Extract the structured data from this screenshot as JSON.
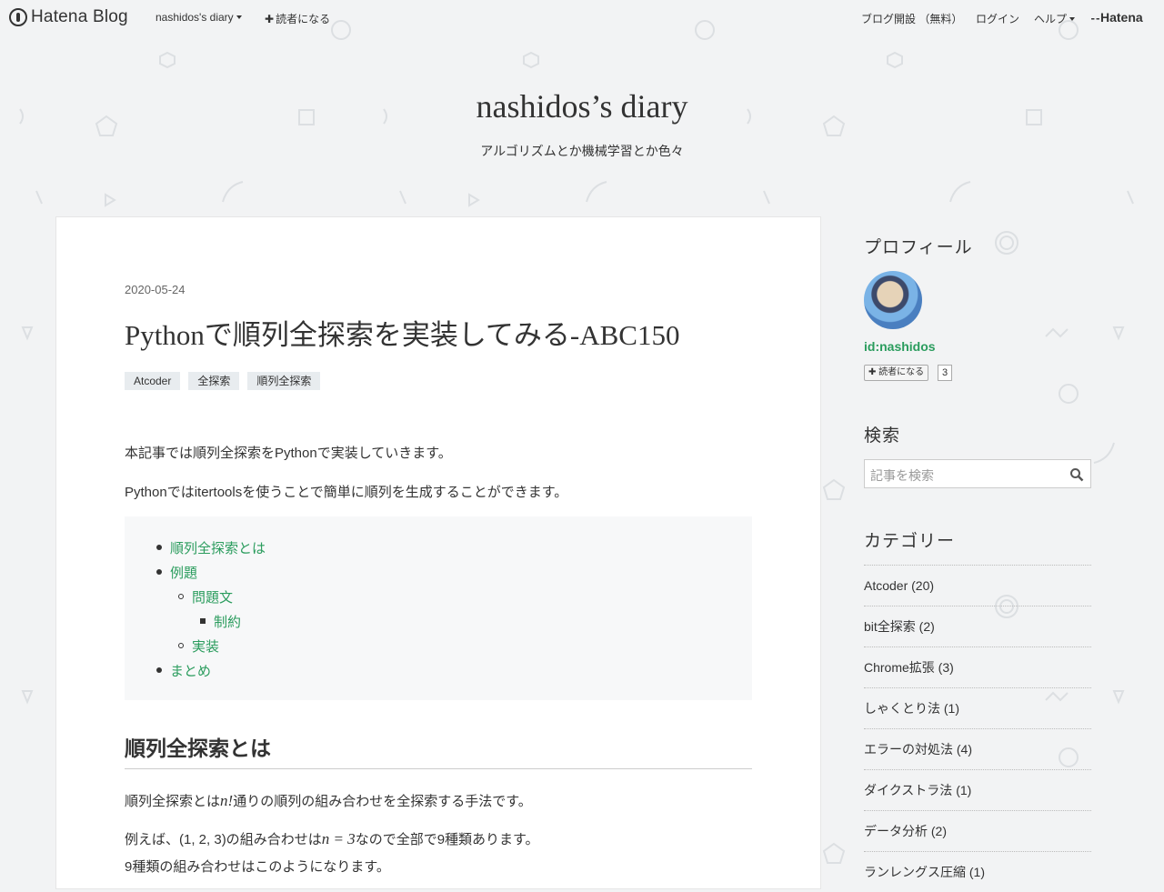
{
  "global_header": {
    "logo": "Hatena Blog",
    "blog_menu": "nashidos's diary",
    "subscribe": "読者になる",
    "open_blog": "ブログ開設 （無料）",
    "login": "ログイン",
    "help": "ヘルプ",
    "hatena": "Hatena"
  },
  "blog": {
    "title": "nashidos’s diary",
    "description": "アルゴリズムとか機械学習とか色々"
  },
  "entry": {
    "date": "2020-05-24",
    "title": "Pythonで順列全探索を実装してみる-ABC150",
    "tags": [
      "Atcoder",
      "全探索",
      "順列全探索"
    ],
    "intro1": "本記事では順列全探索をPythonで実装していきます。",
    "intro2": "Pythonではitertoolsを使うことで簡単に順列を生成することができます。",
    "toc": [
      "順列全探索とは",
      "例題",
      "問題文",
      "制約",
      "実装",
      "まとめ"
    ],
    "section_heading": "順列全探索とは",
    "body1_pre": "順列全探索とは",
    "body1_math": "n!",
    "body1_post": "通りの順列の組み合わせを全探索する手法です。",
    "body2_pre": "例えば、(1, 2, 3)の組み合わせは",
    "body2_math": "n = 3",
    "body2_post": "なので全部で9種類あります。",
    "body3": "9種類の組み合わせはこのようになります。"
  },
  "sidebar": {
    "profile_heading": "プロフィール",
    "profile_id": "id:nashidos",
    "subscribe_label": "読者になる",
    "subscriber_count": "3",
    "search_heading": "検索",
    "search_placeholder": "記事を検索",
    "category_heading": "カテゴリー",
    "categories": [
      "Atcoder (20)",
      "bit全探索 (2)",
      "Chrome拡張 (3)",
      "しゃくとり法 (1)",
      "エラーの対処法 (4)",
      "ダイクストラ法 (1)",
      "データ分析 (2)",
      "ランレングス圧縮 (1)"
    ]
  },
  "colors": {
    "accent_green": "#2a9c5d",
    "background": "#f2f3f4",
    "text": "#333333"
  }
}
